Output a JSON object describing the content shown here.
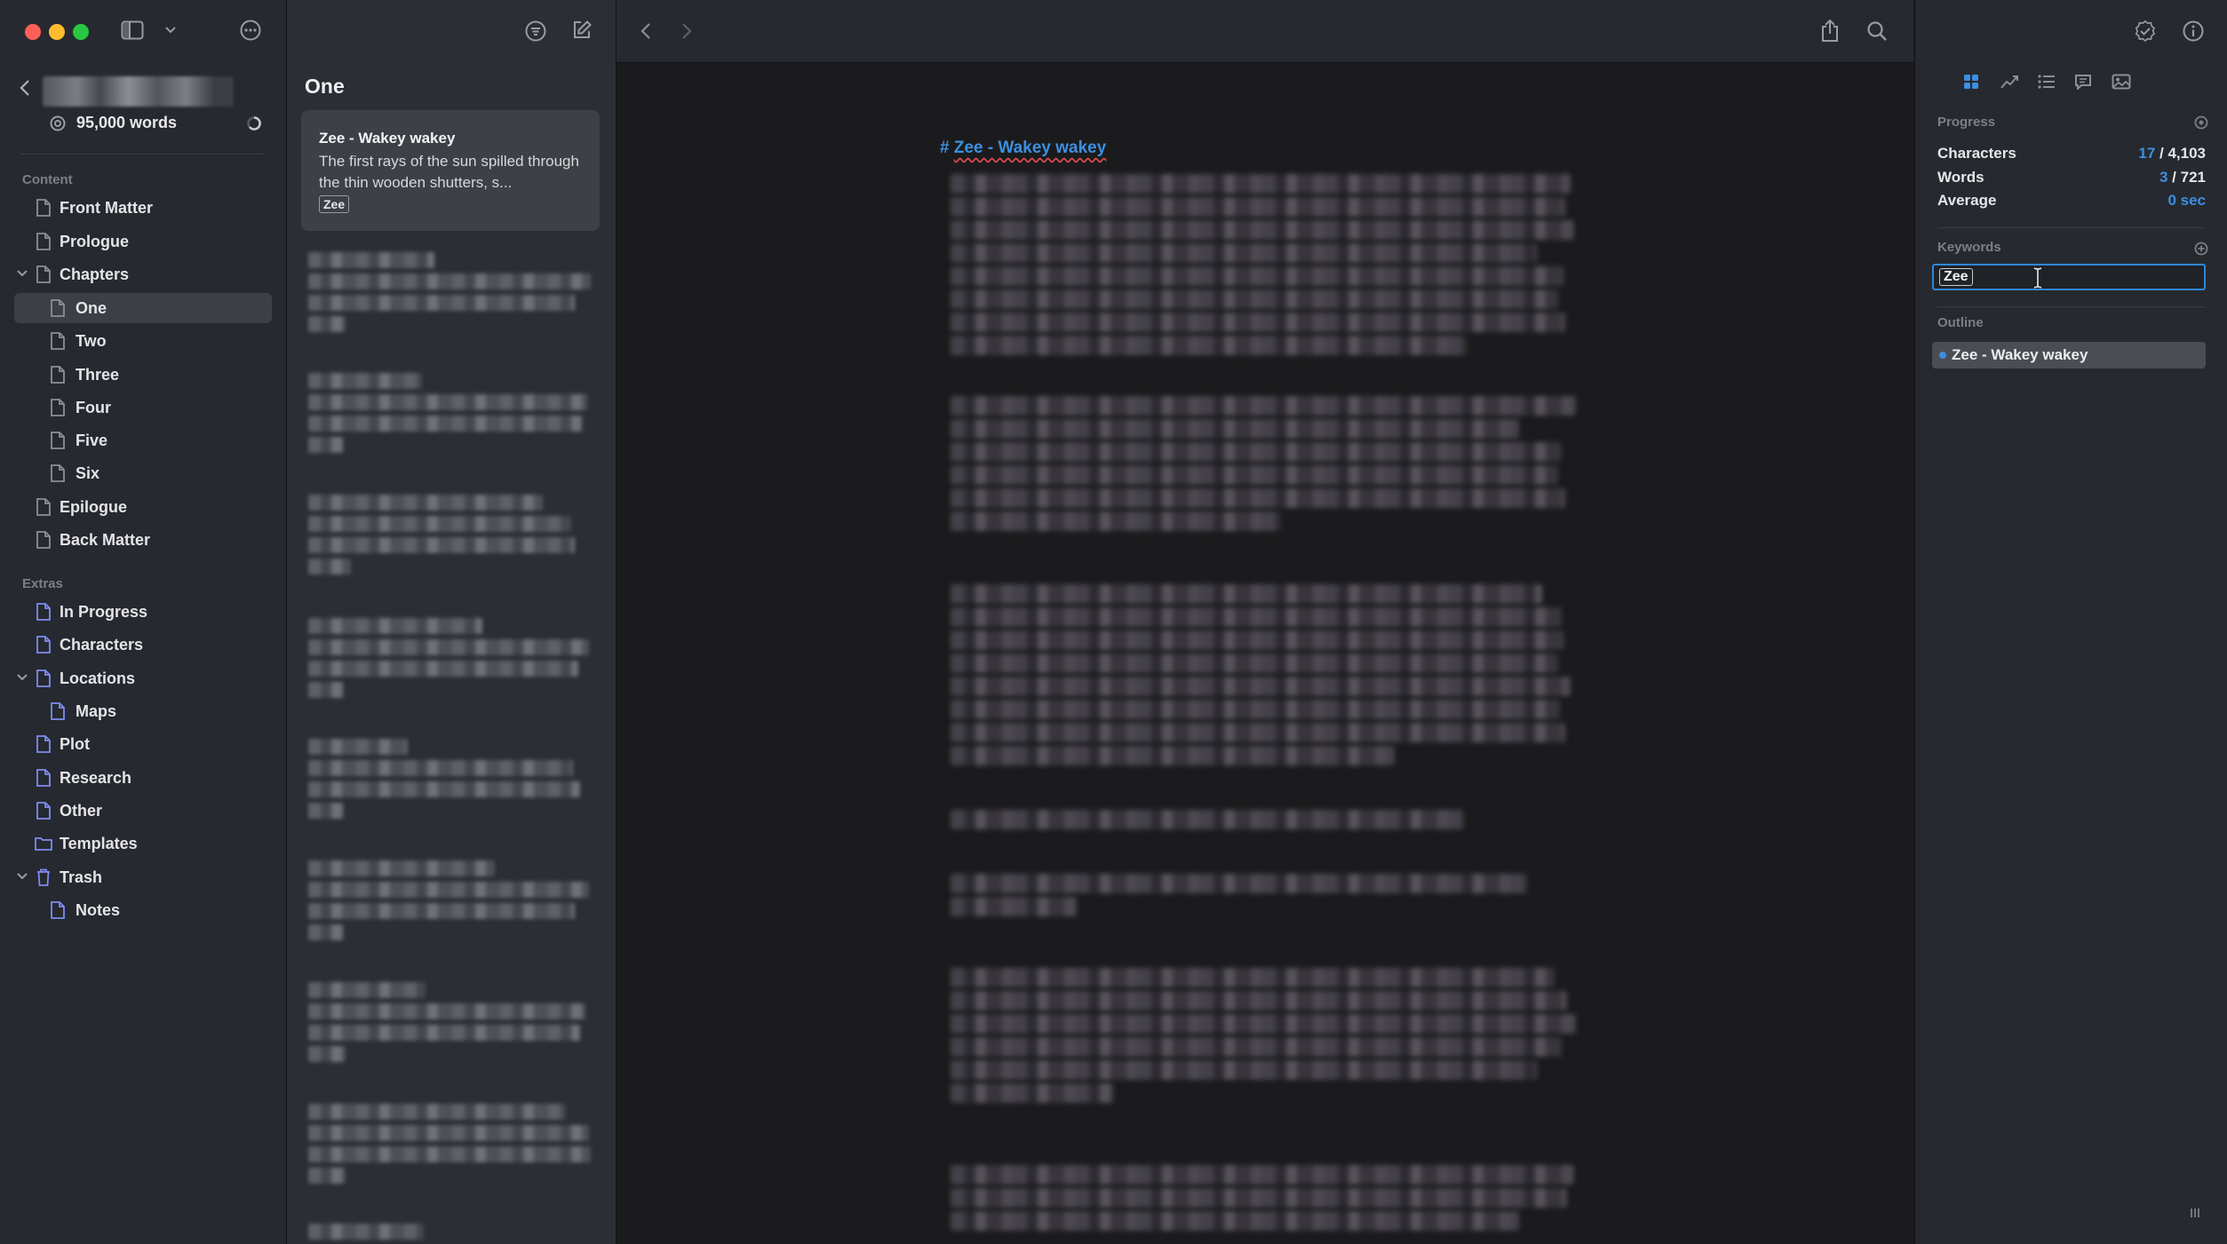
{
  "sidebar": {
    "word_count": "95,000 words",
    "sections": {
      "content": "Content",
      "extras": "Extras"
    },
    "items": [
      {
        "label": "Front Matter"
      },
      {
        "label": "Prologue"
      },
      {
        "label": "Chapters"
      },
      {
        "label": "One"
      },
      {
        "label": "Two"
      },
      {
        "label": "Three"
      },
      {
        "label": "Four"
      },
      {
        "label": "Five"
      },
      {
        "label": "Six"
      },
      {
        "label": "Epilogue"
      },
      {
        "label": "Back Matter"
      },
      {
        "label": "In Progress"
      },
      {
        "label": "Characters"
      },
      {
        "label": "Locations"
      },
      {
        "label": "Maps"
      },
      {
        "label": "Plot"
      },
      {
        "label": "Research"
      },
      {
        "label": "Other"
      },
      {
        "label": "Templates"
      },
      {
        "label": "Trash"
      },
      {
        "label": "Notes"
      }
    ]
  },
  "doclist": {
    "title": "One",
    "card": {
      "title": "Zee - Wakey wakey",
      "excerpt": "The first rays of the sun spilled through the thin wooden shutters, s...",
      "tag": "Zee"
    }
  },
  "editor": {
    "heading_marker": "#",
    "heading_text": "Zee - Wakey wakey"
  },
  "inspector": {
    "progress_label": "Progress",
    "characters_label": "Characters",
    "characters_current": "17",
    "characters_total": " / 4,103",
    "words_label": "Words",
    "words_current": "3",
    "words_total": " / 721",
    "average_label": "Average",
    "average_value": "0 sec",
    "keywords_label": "Keywords",
    "keyword": "Zee",
    "outline_label": "Outline",
    "outline_item": "Zee - Wakey wakey"
  },
  "colors": {
    "accent": "#3c8fe0",
    "close": "#ff5f57",
    "minimize": "#febc2e",
    "zoom": "#28c840",
    "project_icon": "#7e8df0"
  }
}
